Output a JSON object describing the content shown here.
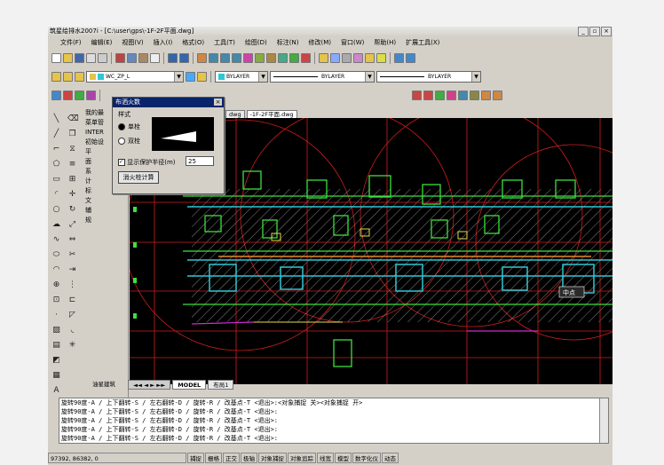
{
  "window": {
    "title": "筑星给排水2007i - [C:\\user\\gps\\-1F-2F平面.dwg]"
  },
  "menu": [
    "文件(F)",
    "编辑(E)",
    "视图(V)",
    "插入(I)",
    "格式(O)",
    "工具(T)",
    "绘图(D)",
    "标注(N)",
    "修改(M)",
    "窗口(W)",
    "帮助(H)",
    "扩展工具(X)"
  ],
  "toolbar": {
    "layer": "WC_ZP_L",
    "color": "BYLAYER",
    "linetype": "BYLAYER",
    "lineweight": "BYLAYER"
  },
  "sidepanel": {
    "items": [
      "我的最",
      "菜单管",
      "INTER",
      "",
      "初始设",
      "平",
      "面",
      "系",
      "计",
      "标",
      "文",
      "辅",
      "规"
    ],
    "footer": "油星建筑"
  },
  "doc_tabs": [
    "dwg",
    "-1F-2F平面.dwg"
  ],
  "layout_tabs": [
    "MODEL",
    "布局1"
  ],
  "dialog": {
    "title": "布洒火数",
    "style_label": "样式",
    "radio1": "单栓",
    "radio2": "双栓",
    "checkbox": "显示保护半径(m)",
    "radius_value": "25",
    "button": "消火栓计算"
  },
  "canvas": {
    "label": "中点"
  },
  "command_lines": [
    "旋转90度-A / 上下翻转-S / 左右翻转-D / 旋转-R / 改基点-T <退出>:<对象捕捉 关><对象捕捉 开>",
    "旋转90度-A / 上下翻转-S / 左右翻转-D / 旋转-R / 改基点-T <退出>:",
    "旋转90度-A / 上下翻转-S / 左右翻转-D / 旋转-R / 改基点-T <退出>:",
    "旋转90度-A / 上下翻转-S / 左右翻转-D / 旋转-R / 改基点-T <退出>:",
    "旋转90度-A / 上下翻转-S / 左右翻转-D / 旋转-R / 改基点-T <退出>:"
  ],
  "status": {
    "coords": "97392, 86382, 0",
    "toggles": [
      "捕捉",
      "栅格",
      "正交",
      "极轴",
      "对象捕捉",
      "对象追踪",
      "线宽",
      "模型",
      "数字化仪",
      "动态"
    ]
  },
  "colors": {
    "app_bg": "#d4d0c8",
    "canvas_bg": "#000000",
    "cyan": "#2fc7d4",
    "green": "#3ce13c",
    "red": "#d21e1e",
    "magenta": "#d02ad0"
  }
}
